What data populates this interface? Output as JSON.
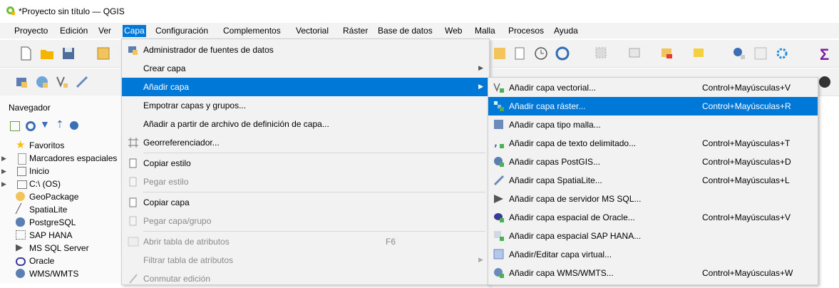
{
  "window": {
    "title": "*Proyecto sin título — QGIS"
  },
  "menubar": [
    "Proyecto",
    "Edición",
    "Ver",
    "Capa",
    "Configuración",
    "Complementos",
    "Vectorial",
    "Ráster",
    "Base de datos",
    "Web",
    "Malla",
    "Procesos",
    "Ayuda"
  ],
  "active_menu": "Capa",
  "navigator": {
    "title": "Navegador",
    "items": [
      {
        "label": "Favoritos",
        "icon": "star-icon"
      },
      {
        "label": "Marcadores espaciales",
        "icon": "bookmark-icon"
      },
      {
        "label": "Inicio",
        "icon": "home-folder-icon"
      },
      {
        "label": "C:\\ (OS)",
        "icon": "drive-icon"
      },
      {
        "label": "GeoPackage",
        "icon": "geopackage-icon"
      },
      {
        "label": "SpatiaLite",
        "icon": "spatialite-icon"
      },
      {
        "label": "PostgreSQL",
        "icon": "postgresql-icon"
      },
      {
        "label": "SAP HANA",
        "icon": "sap-hana-icon"
      },
      {
        "label": "MS SQL Server",
        "icon": "mssql-icon"
      },
      {
        "label": "Oracle",
        "icon": "oracle-icon"
      },
      {
        "label": "WMS/WMTS",
        "icon": "wms-icon"
      }
    ]
  },
  "capa_menu": [
    {
      "label": "Administrador de fuentes de datos",
      "icon": "data-source-manager-icon"
    },
    {
      "label": "Crear capa",
      "submenu": true
    },
    {
      "label": "Añadir capa",
      "submenu": true,
      "highlighted": true
    },
    {
      "label": "Empotrar capas y grupos..."
    },
    {
      "label": "Añadir a partir de archivo de definición de capa..."
    },
    {
      "label": "Georreferenciador...",
      "icon": "georeferencer-icon"
    },
    {
      "label": "Copiar estilo",
      "icon": "copy-style-icon"
    },
    {
      "label": "Pegar estilo",
      "icon": "paste-style-icon",
      "disabled": true
    },
    {
      "label": "Copiar capa",
      "icon": "copy-layer-icon"
    },
    {
      "label": "Pegar capa/grupo",
      "icon": "paste-layer-icon",
      "disabled": true
    },
    {
      "label": "Abrir tabla de atributos",
      "icon": "attribute-table-icon",
      "shortcut": "F6",
      "disabled": true
    },
    {
      "label": "Filtrar tabla de atributos",
      "submenu": true,
      "disabled": true
    },
    {
      "label": "Conmutar edición",
      "icon": "toggle-edit-icon",
      "disabled": true
    }
  ],
  "add_layer_submenu": [
    {
      "label": "Añadir capa vectorial...",
      "shortcut": "Control+Mayúsculas+V",
      "icon": "add-vector-icon"
    },
    {
      "label": "Añadir capa ráster...",
      "shortcut": "Control+Mayúsculas+R",
      "icon": "add-raster-icon",
      "highlighted": true
    },
    {
      "label": "Añadir capa tipo malla...",
      "shortcut": "",
      "icon": "add-mesh-icon"
    },
    {
      "label": "Añadir capa de texto delimitado...",
      "shortcut": "Control+Mayúsculas+T",
      "icon": "add-delimited-text-icon"
    },
    {
      "label": "Añadir capas PostGIS...",
      "shortcut": "Control+Mayúsculas+D",
      "icon": "add-postgis-icon"
    },
    {
      "label": "Añadir capa SpatiaLite...",
      "shortcut": "Control+Mayúsculas+L",
      "icon": "add-spatialite-icon"
    },
    {
      "label": "Añadir capa de servidor MS SQL...",
      "shortcut": "",
      "icon": "add-mssql-icon"
    },
    {
      "label": "Añadir capa espacial de Oracle...",
      "shortcut": "Control+Mayúsculas+V",
      "icon": "add-oracle-icon"
    },
    {
      "label": "Añadir capa espacial SAP HANA...",
      "shortcut": "",
      "icon": "add-hana-icon"
    },
    {
      "label": "Añadir/Editar capa virtual...",
      "shortcut": "",
      "icon": "add-virtual-layer-icon"
    },
    {
      "label": "Añadir capa WMS/WMTS...",
      "shortcut": "Control+Mayúsculas+W",
      "icon": "add-wms-icon"
    }
  ],
  "toolbar_sigma": "Σ"
}
